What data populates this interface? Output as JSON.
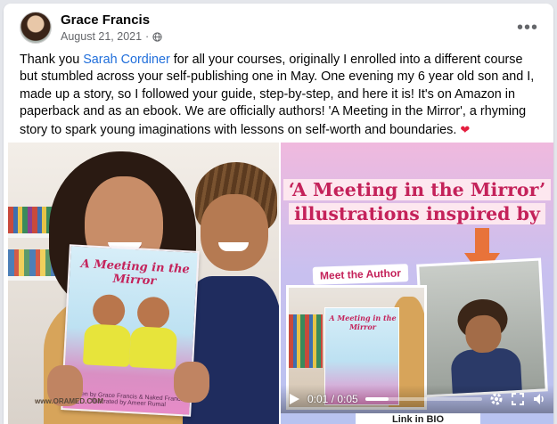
{
  "post": {
    "author_name": "Grace Francis",
    "date": "August 21, 2021",
    "separator": "·",
    "more_label": "•••",
    "text_before_mention": "Thank you ",
    "mention": "Sarah Cordiner",
    "text_after_mention": " for all your courses, originally I enrolled into a different course but stumbled across your self-publishing one in May. One evening my 6 year old son and I, made up a story, so I followed your guide, step-by-step, and here it is! It's on Amazon in paperback and as an ebook.  We are officially authors! 'A Meeting in the Mirror', a rhyming story to spark young imaginations with lessons on self-worth and boundaries.",
    "heart": "❤"
  },
  "media_left": {
    "book_title": "A Meeting in the Mirror",
    "book_footer": "Written by Grace Francis & Naked Francis · Illustrated by Ameer Rumal",
    "watermark": "www.ORAMED.COM"
  },
  "media_right": {
    "promo_line1": "‘A Meeting in the Mirror’",
    "promo_line2": "illustrations inspired by",
    "meet_badge": "Meet the Author",
    "thumb_book_title": "A Meeting in the Mirror",
    "video": {
      "time_current": "0:01",
      "time_total": "0:05",
      "progress_fraction": 0.2,
      "caption": "Link in BIO"
    }
  },
  "colors": {
    "mention": "#216fdb",
    "accent_pink": "#c4225a",
    "secondary_text": "#65676b"
  },
  "icons": {
    "globe": "globe-icon",
    "more": "more-horizontal-icon",
    "play": "play-icon",
    "settings": "gear-icon",
    "fullscreen": "expand-icon",
    "volume": "volume-icon",
    "arrow": "arrow-down-icon"
  }
}
